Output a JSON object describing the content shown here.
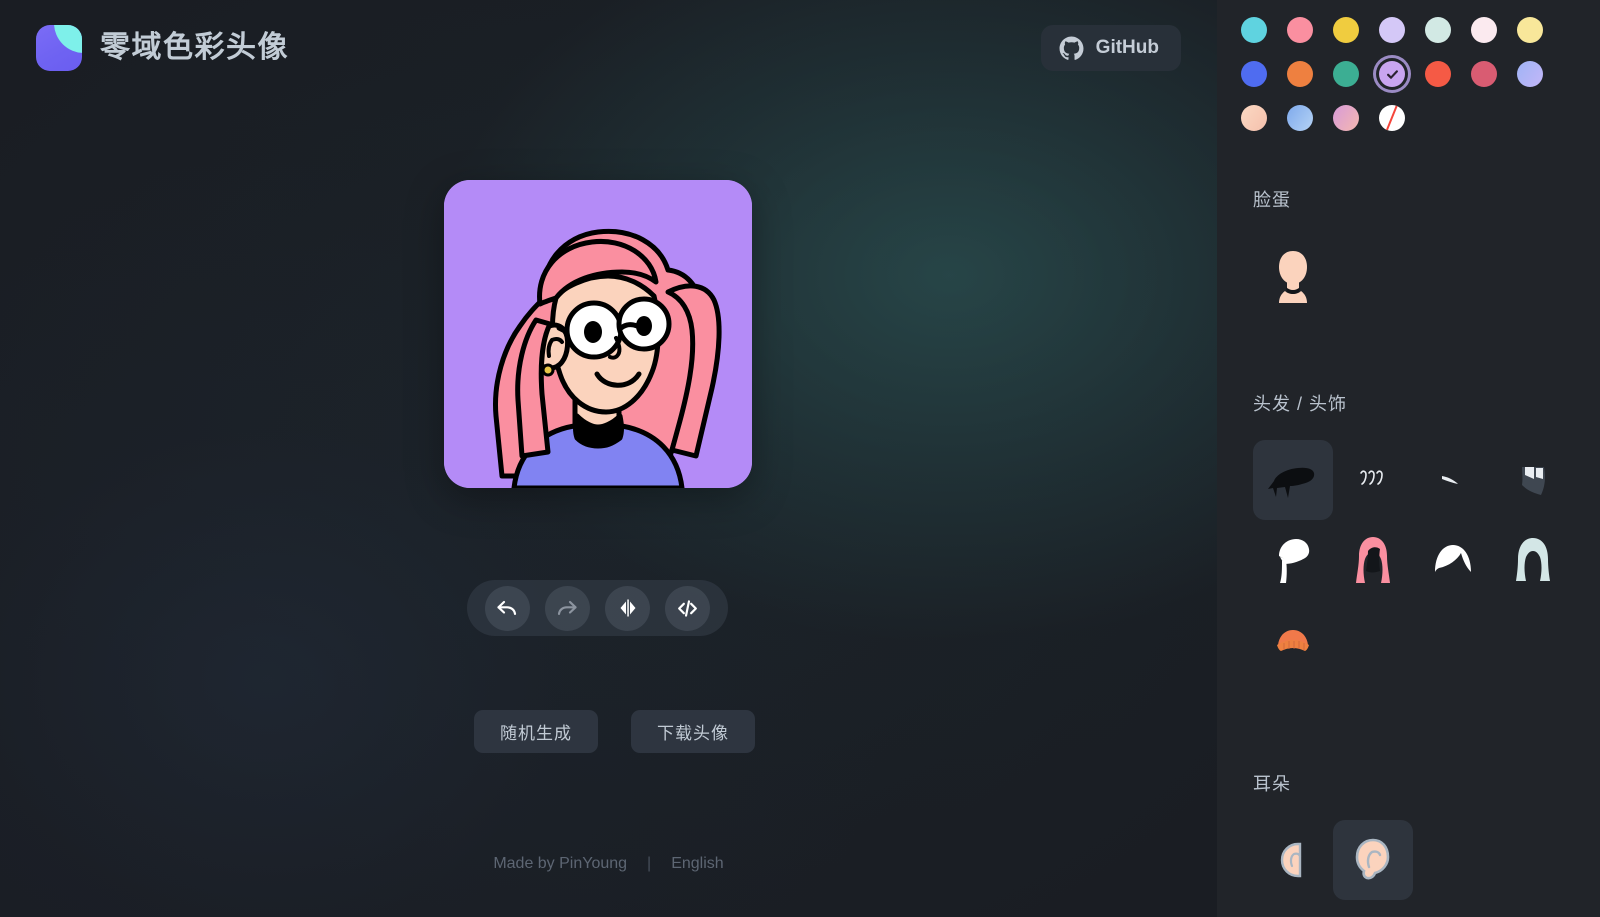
{
  "app": {
    "title": "零域色彩头像",
    "logo_icon": "app-logo-icon"
  },
  "header": {
    "github_label": "GitHub",
    "github_icon": "github-icon"
  },
  "preview": {
    "background_color": "#b48bf7",
    "hair_color": "#fa8fa0",
    "skin_color": "#fbd3bd",
    "shirt_color": "#8183f2",
    "earring_color": "#e8c547",
    "line_color": "#000000"
  },
  "toolbar": {
    "buttons": [
      {
        "name": "undo",
        "icon": "undo-arrow-icon",
        "enabled": true
      },
      {
        "name": "redo",
        "icon": "redo-arrow-icon",
        "enabled": false
      },
      {
        "name": "flip",
        "icon": "mirror-flip-icon",
        "enabled": true
      },
      {
        "name": "code",
        "icon": "code-brackets-icon",
        "enabled": true
      }
    ]
  },
  "actions": {
    "random_label": "随机生成",
    "download_label": "下载头像"
  },
  "footer": {
    "made_by": "Made by PinYoung",
    "divider": "|",
    "language": "English"
  },
  "sidebar": {
    "collapse_icon": "chevron-right-icon",
    "palette": {
      "selected_index": 10,
      "swatches": [
        {
          "id": "cyan",
          "color": "#5fd3e0",
          "type": "solid"
        },
        {
          "id": "pink",
          "color": "#fa8fa0",
          "type": "solid"
        },
        {
          "id": "yellow",
          "color": "#f0cc3f",
          "type": "solid"
        },
        {
          "id": "lavender",
          "color": "#d4c8f7",
          "type": "solid"
        },
        {
          "id": "pale-mint",
          "color": "#d2e9e4",
          "type": "solid"
        },
        {
          "id": "pale-pink",
          "color": "#fbeaef",
          "type": "solid"
        },
        {
          "id": "pale-yellow",
          "color": "#f8e79a",
          "type": "solid"
        },
        {
          "id": "blue",
          "color": "#4f6cf0",
          "type": "solid"
        },
        {
          "id": "orange",
          "color": "#ee8040",
          "type": "solid"
        },
        {
          "id": "teal-green",
          "color": "#3cae93",
          "type": "solid"
        },
        {
          "id": "purple",
          "color": "#c9a5f0",
          "type": "solid"
        },
        {
          "id": "red-orange",
          "color": "#f55a45",
          "type": "solid"
        },
        {
          "id": "rose",
          "color": "#d95c72",
          "type": "solid"
        },
        {
          "id": "blue-violet",
          "color": "#9fb4f5",
          "type": "gradient",
          "color2": "#c3b6f8"
        },
        {
          "id": "peach-grad",
          "color": "#fbd9c3",
          "type": "gradient",
          "color2": "#f5c0ac"
        },
        {
          "id": "blue-grad",
          "color": "#7ea9ec",
          "type": "gradient",
          "color2": "#b5d3f5"
        },
        {
          "id": "pink-purple",
          "color": "#d79ad8",
          "type": "gradient",
          "color2": "#f5b8b0"
        },
        {
          "id": "none",
          "color": "#ffffff",
          "type": "none"
        }
      ]
    },
    "sections": [
      {
        "id": "face",
        "title": "脸蛋",
        "items": [
          {
            "id": "face-1",
            "icon": "face-shape-icon",
            "selected": false
          }
        ]
      },
      {
        "id": "hair",
        "title": "头发 / 头饰",
        "items": [
          {
            "id": "hair-1",
            "icon": "hair-black-flat-icon",
            "selected": true
          },
          {
            "id": "hair-2",
            "icon": "hair-curls-icon",
            "selected": false
          },
          {
            "id": "hair-3",
            "icon": "hair-wisp-icon",
            "selected": false
          },
          {
            "id": "hair-4",
            "icon": "hair-cap-icon",
            "selected": false
          },
          {
            "id": "hair-5",
            "icon": "hair-ponytail-icon",
            "selected": false
          },
          {
            "id": "hair-6",
            "icon": "hair-long-pink-icon",
            "selected": false
          },
          {
            "id": "hair-7",
            "icon": "hair-short-white-icon",
            "selected": false
          },
          {
            "id": "hair-8",
            "icon": "hair-bob-blue-icon",
            "selected": false
          },
          {
            "id": "hair-9",
            "icon": "beanie-hat-orange-icon",
            "selected": false
          }
        ]
      },
      {
        "id": "ears",
        "title": "耳朵",
        "items": [
          {
            "id": "ear-1",
            "icon": "ear-small-icon",
            "selected": false
          },
          {
            "id": "ear-2",
            "icon": "ear-large-icon",
            "selected": true
          }
        ]
      }
    ]
  }
}
